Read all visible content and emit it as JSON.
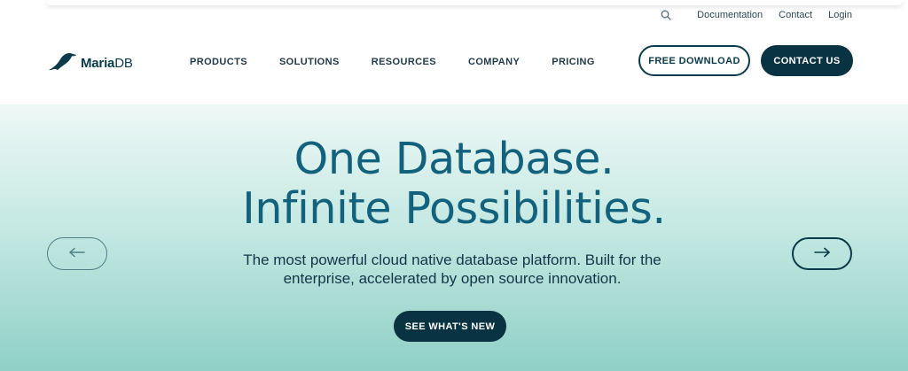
{
  "utility_nav": {
    "search_icon": "search-icon",
    "links": [
      "Documentation",
      "Contact",
      "Login"
    ]
  },
  "brand": {
    "logo_icon": "sea-lion-icon",
    "name_bold": "Maria",
    "name_light": "DB"
  },
  "main_nav": {
    "items": [
      "PRODUCTS",
      "SOLUTIONS",
      "RESOURCES",
      "COMPANY",
      "PRICING"
    ]
  },
  "header_actions": {
    "free_download": "FREE DOWNLOAD",
    "contact_us": "CONTACT US"
  },
  "hero": {
    "headline_line1": "One Database.",
    "headline_line2": "Infinite Possibilities.",
    "subtext_line1": "The most powerful cloud native database platform. Built for the",
    "subtext_line2": "enterprise, accelerated by open source innovation.",
    "cta": "SEE WHAT'S NEW",
    "prev_icon": "arrow-left-icon",
    "next_icon": "arrow-right-icon"
  },
  "colors": {
    "brand_dark": "#093242",
    "headline": "#12627e",
    "hero_gradient_top": "#eef8f6",
    "hero_gradient_bottom": "#8fd0c7"
  }
}
